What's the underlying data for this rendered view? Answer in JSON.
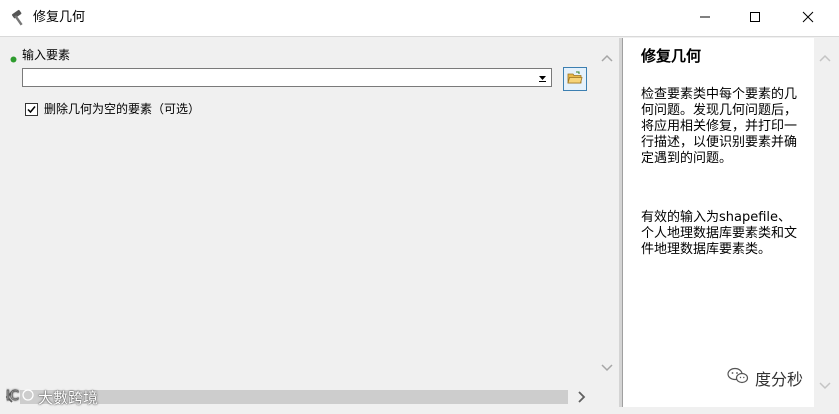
{
  "window": {
    "title": "修复几何",
    "controls": {
      "minimize_icon": "minimize-icon",
      "maximize_icon": "maximize-icon",
      "close_icon": "close-icon"
    }
  },
  "form": {
    "input_features": {
      "label": "输入要素",
      "value": "",
      "required": true,
      "required_color": "#2e9c2e",
      "browse_icon": "open-folder-icon"
    },
    "delete_null": {
      "label": "删除几何为空的要素（可选）",
      "checked": true
    }
  },
  "help": {
    "title": "修复几何",
    "paragraph1": "检查要素类中每个要素的几何问题。发现几何问题后，将应用相关修复，并打印一行描述，以便识别要素并确定遇到的问题。",
    "paragraph2": "有效的输入为shapefile、个人地理数据库要素类和文件地理数据库要素类。"
  },
  "watermarks": {
    "right": "度分秒",
    "left": "大數跨境"
  },
  "colors": {
    "accent": "#3c7fb1",
    "panel_bg": "#f0f0f0"
  }
}
